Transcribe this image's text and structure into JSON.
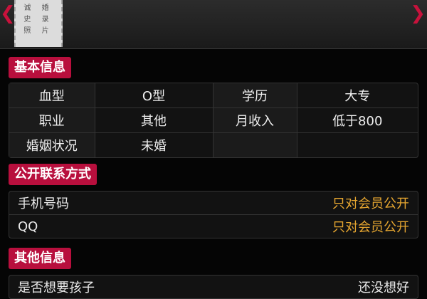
{
  "photo": {
    "text_lines": [
      "诚 婚",
      "史 录",
      "照 片"
    ]
  },
  "nav": {
    "prev_glyph": "❮",
    "next_glyph": "❯"
  },
  "basic": {
    "title": "基本信息",
    "rows": [
      [
        {
          "label": "血型",
          "value": "O型"
        },
        {
          "label": "学历",
          "value": "大专"
        }
      ],
      [
        {
          "label": "职业",
          "value": "其他"
        },
        {
          "label": "月收入",
          "value": "低于800"
        }
      ],
      [
        {
          "label": "婚姻状况",
          "value": "未婚"
        },
        {
          "label": "",
          "value": ""
        }
      ]
    ]
  },
  "contact": {
    "title": "公开联系方式",
    "items": [
      {
        "label": "手机号码",
        "value": "只对会员公开"
      },
      {
        "label": "QQ",
        "value": "只对会员公开"
      }
    ]
  },
  "other": {
    "title": "其他信息",
    "items": [
      {
        "label": "是否想要孩子",
        "value": "还没想好"
      }
    ]
  },
  "colors": {
    "accent": "#b80f3d",
    "gold": "#e6a630",
    "background": "#050505"
  }
}
